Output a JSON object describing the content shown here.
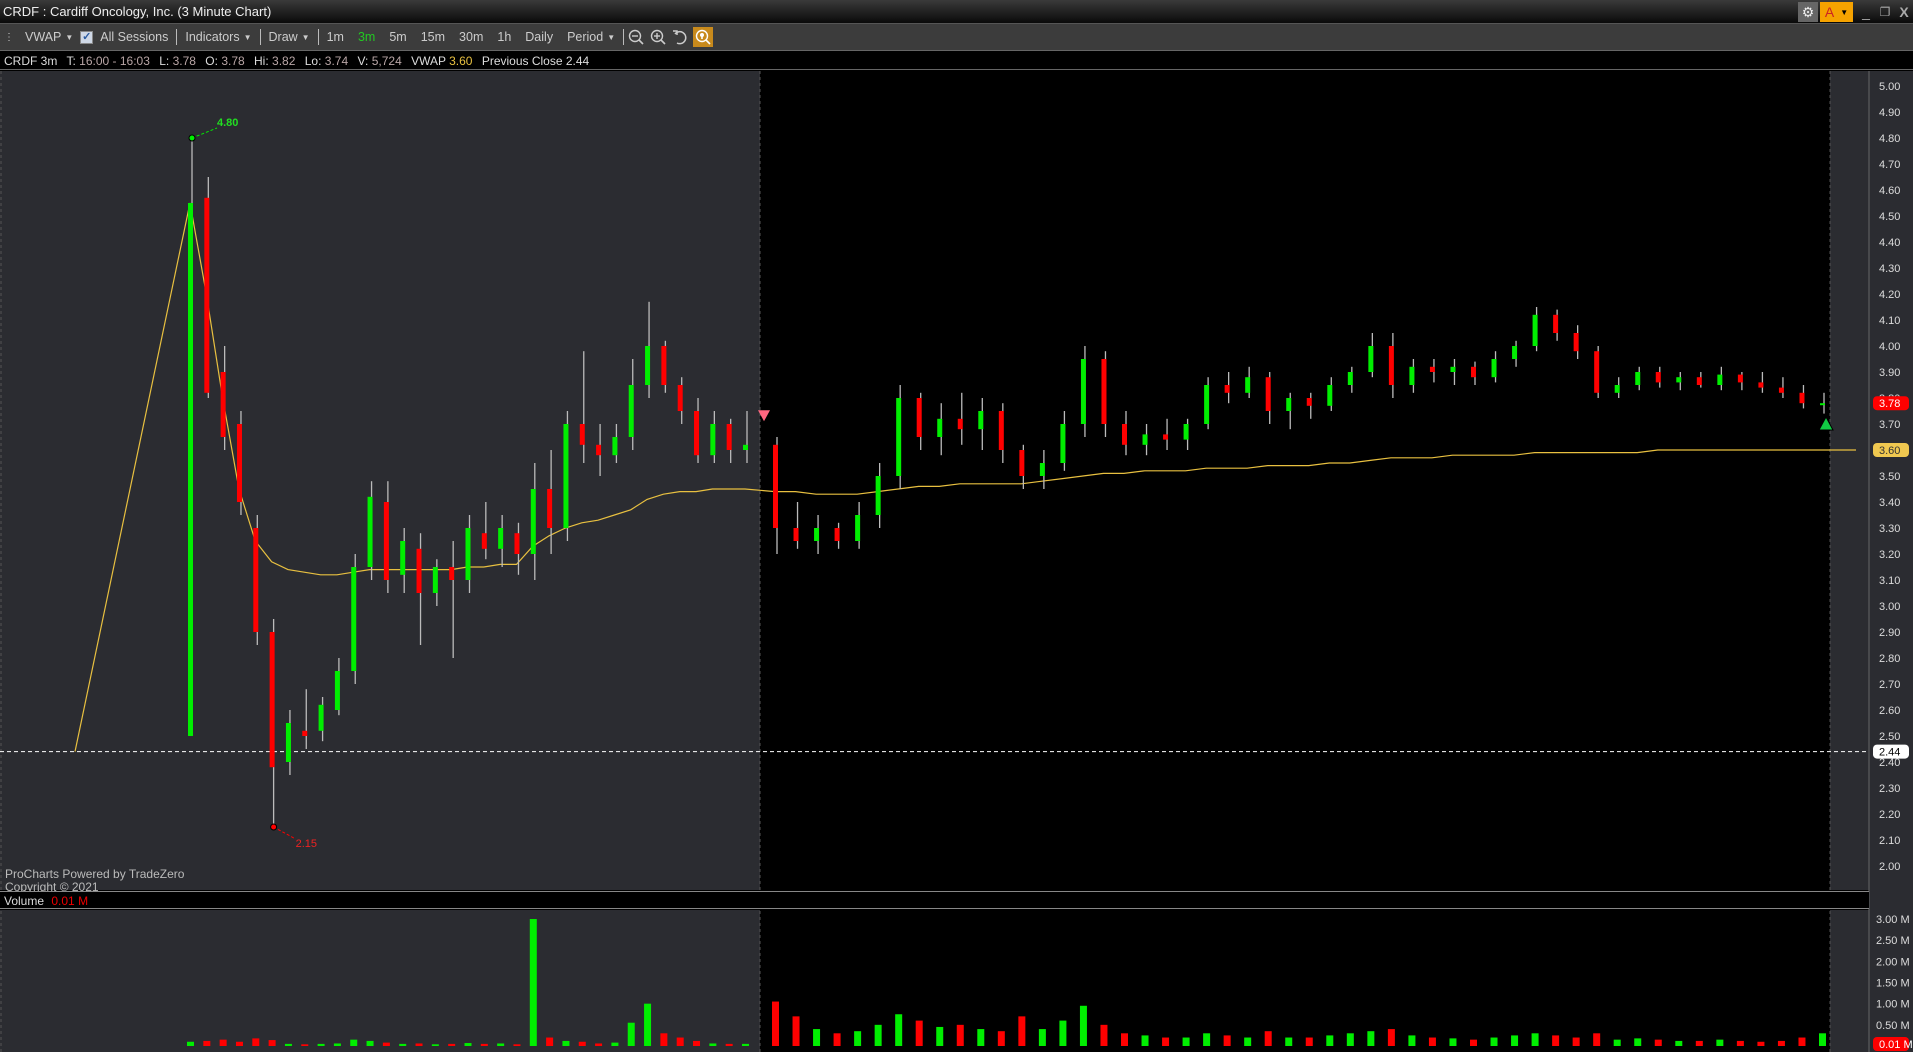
{
  "window": {
    "title": "CRDF : Cardiff Oncology, Inc. (3 Minute Chart)",
    "settings_icon": "gear-icon",
    "theme_button": "A",
    "minimize": "_",
    "restore": "❐",
    "close": "X"
  },
  "toolbar": {
    "vwap": "VWAP",
    "all_sessions": "All Sessions",
    "all_sessions_checked": true,
    "indicators": "Indicators",
    "draw": "Draw",
    "periods": [
      "1m",
      "3m",
      "5m",
      "15m",
      "30m",
      "1h",
      "Daily"
    ],
    "active_period": "3m",
    "period": "Period",
    "active_color": "#22c822"
  },
  "info": {
    "symbol": "CRDF 3m",
    "t_label": "T:",
    "t_value": "16:00 - 16:03",
    "l_label": "L:",
    "l_value": "3.78",
    "o_label": "O:",
    "o_value": "3.78",
    "hi_label": "Hi:",
    "hi_value": "3.82",
    "lo_label": "Lo:",
    "lo_value": "3.74",
    "v_label": "V:",
    "v_value": "5,724",
    "vwap_label": "VWAP",
    "vwap_value": "3.60",
    "prev_label": "Previous Close",
    "prev_value": "2.44"
  },
  "footer": {
    "line1": "ProCharts Powered by TradeZero",
    "line2": "Copyright © 2021"
  },
  "volume": {
    "label": "Volume",
    "value": "0.01 M"
  },
  "colors": {
    "up": "#00ee00",
    "down": "#ff0000",
    "vwap": "#e8c040",
    "premarket_bg": "#2b2c31",
    "regular_bg": "#000000"
  },
  "chart_data": {
    "type": "candlestick",
    "title": "CRDF : Cardiff Oncology, Inc. (3 Minute Chart)",
    "y_ticks": [
      "5.00",
      "4.90",
      "4.80",
      "4.70",
      "4.60",
      "4.50",
      "4.40",
      "4.30",
      "4.20",
      "4.10",
      "4.00",
      "3.90",
      "3.80",
      "3.70",
      "3.60",
      "3.50",
      "3.40",
      "3.30",
      "3.20",
      "3.10",
      "3.00",
      "2.90",
      "2.80",
      "2.70",
      "2.60",
      "2.50",
      "2.40",
      "2.30",
      "2.20",
      "2.10",
      "2.00"
    ],
    "ylim": [
      2.0,
      5.0
    ],
    "vol_ticks": [
      "3.00 M",
      "2.50 M",
      "2.00 M",
      "1.50 M",
      "1.00 M",
      "0.50 M"
    ],
    "vol_ylim": [
      0,
      3.0
    ],
    "last_price": "3.78",
    "vwap_last": "3.60",
    "prev_close": 2.44,
    "prev_close_label": "2.44",
    "vol_last": "0.01 M",
    "high_marker": {
      "index": 0,
      "value": 4.8,
      "label": "4.80"
    },
    "low_marker": {
      "index": 5,
      "value": 2.15,
      "label": "2.15"
    },
    "premarket_count": 35,
    "vwap_start": 2.44,
    "candles_ohlcv": [
      [
        2.5,
        4.8,
        2.5,
        4.55,
        0.1
      ],
      [
        4.57,
        4.65,
        3.8,
        3.82,
        0.12
      ],
      [
        3.9,
        4.0,
        3.6,
        3.65,
        0.15
      ],
      [
        3.7,
        3.75,
        3.35,
        3.4,
        0.1
      ],
      [
        3.3,
        3.35,
        2.85,
        2.9,
        0.18
      ],
      [
        2.9,
        2.95,
        2.15,
        2.38,
        0.14
      ],
      [
        2.4,
        2.6,
        2.35,
        2.55,
        0.05
      ],
      [
        2.52,
        2.68,
        2.45,
        2.5,
        0.04
      ],
      [
        2.52,
        2.65,
        2.48,
        2.62,
        0.05
      ],
      [
        2.6,
        2.8,
        2.58,
        2.75,
        0.06
      ],
      [
        2.75,
        3.2,
        2.7,
        3.15,
        0.15
      ],
      [
        3.15,
        3.48,
        3.1,
        3.42,
        0.12
      ],
      [
        3.4,
        3.48,
        3.05,
        3.1,
        0.08
      ],
      [
        3.12,
        3.3,
        3.05,
        3.25,
        0.05
      ],
      [
        3.22,
        3.28,
        2.85,
        3.05,
        0.06
      ],
      [
        3.05,
        3.18,
        3.0,
        3.15,
        0.04
      ],
      [
        3.15,
        3.25,
        2.8,
        3.1,
        0.05
      ],
      [
        3.1,
        3.35,
        3.05,
        3.3,
        0.07
      ],
      [
        3.28,
        3.4,
        3.18,
        3.22,
        0.05
      ],
      [
        3.22,
        3.35,
        3.15,
        3.3,
        0.06
      ],
      [
        3.28,
        3.32,
        3.12,
        3.2,
        0.04
      ],
      [
        3.2,
        3.55,
        3.1,
        3.45,
        3.0
      ],
      [
        3.45,
        3.6,
        3.2,
        3.3,
        0.2
      ],
      [
        3.3,
        3.75,
        3.25,
        3.7,
        0.12
      ],
      [
        3.7,
        3.98,
        3.55,
        3.62,
        0.1
      ],
      [
        3.62,
        3.7,
        3.5,
        3.58,
        0.06
      ],
      [
        3.58,
        3.7,
        3.55,
        3.65,
        0.08
      ],
      [
        3.65,
        3.95,
        3.6,
        3.85,
        0.55
      ],
      [
        3.85,
        4.17,
        3.8,
        4.0,
        1.0
      ],
      [
        4.0,
        4.02,
        3.82,
        3.85,
        0.3
      ],
      [
        3.85,
        3.88,
        3.7,
        3.75,
        0.2
      ],
      [
        3.75,
        3.8,
        3.55,
        3.58,
        0.12
      ],
      [
        3.58,
        3.75,
        3.55,
        3.7,
        0.06
      ],
      [
        3.7,
        3.72,
        3.55,
        3.6,
        0.05
      ],
      [
        3.6,
        3.75,
        3.55,
        3.62,
        0.05
      ],
      [
        3.62,
        3.65,
        3.2,
        3.3,
        1.05
      ],
      [
        3.3,
        3.4,
        3.22,
        3.25,
        0.7
      ],
      [
        3.25,
        3.35,
        3.2,
        3.3,
        0.4
      ],
      [
        3.3,
        3.32,
        3.22,
        3.25,
        0.3
      ],
      [
        3.25,
        3.4,
        3.22,
        3.35,
        0.35
      ],
      [
        3.35,
        3.55,
        3.3,
        3.5,
        0.5
      ],
      [
        3.5,
        3.85,
        3.45,
        3.8,
        0.75
      ],
      [
        3.8,
        3.82,
        3.6,
        3.65,
        0.6
      ],
      [
        3.65,
        3.78,
        3.58,
        3.72,
        0.45
      ],
      [
        3.72,
        3.82,
        3.62,
        3.68,
        0.5
      ],
      [
        3.68,
        3.8,
        3.6,
        3.75,
        0.4
      ],
      [
        3.75,
        3.78,
        3.55,
        3.6,
        0.35
      ],
      [
        3.6,
        3.62,
        3.45,
        3.5,
        0.7
      ],
      [
        3.5,
        3.6,
        3.45,
        3.55,
        0.4
      ],
      [
        3.55,
        3.75,
        3.52,
        3.7,
        0.6
      ],
      [
        3.7,
        4.0,
        3.65,
        3.95,
        0.95
      ],
      [
        3.95,
        3.98,
        3.65,
        3.7,
        0.5
      ],
      [
        3.7,
        3.75,
        3.58,
        3.62,
        0.3
      ],
      [
        3.62,
        3.7,
        3.58,
        3.66,
        0.25
      ],
      [
        3.66,
        3.72,
        3.6,
        3.64,
        0.2
      ],
      [
        3.64,
        3.72,
        3.6,
        3.7,
        0.2
      ],
      [
        3.7,
        3.88,
        3.68,
        3.85,
        0.3
      ],
      [
        3.85,
        3.9,
        3.78,
        3.82,
        0.25
      ],
      [
        3.82,
        3.92,
        3.8,
        3.88,
        0.2
      ],
      [
        3.88,
        3.9,
        3.7,
        3.75,
        0.35
      ],
      [
        3.75,
        3.82,
        3.68,
        3.8,
        0.2
      ],
      [
        3.8,
        3.82,
        3.72,
        3.77,
        0.2
      ],
      [
        3.77,
        3.88,
        3.75,
        3.85,
        0.25
      ],
      [
        3.85,
        3.92,
        3.82,
        3.9,
        0.3
      ],
      [
        3.9,
        4.05,
        3.88,
        4.0,
        0.35
      ],
      [
        4.0,
        4.05,
        3.8,
        3.85,
        0.4
      ],
      [
        3.85,
        3.95,
        3.82,
        3.92,
        0.25
      ],
      [
        3.92,
        3.95,
        3.86,
        3.9,
        0.2
      ],
      [
        3.9,
        3.95,
        3.85,
        3.92,
        0.18
      ],
      [
        3.92,
        3.94,
        3.85,
        3.88,
        0.15
      ],
      [
        3.88,
        3.98,
        3.86,
        3.95,
        0.2
      ],
      [
        3.95,
        4.02,
        3.92,
        4.0,
        0.25
      ],
      [
        4.0,
        4.15,
        3.98,
        4.12,
        0.3
      ],
      [
        4.12,
        4.14,
        4.02,
        4.05,
        0.25
      ],
      [
        4.05,
        4.08,
        3.95,
        3.98,
        0.2
      ],
      [
        3.98,
        4.0,
        3.8,
        3.82,
        0.3
      ],
      [
        3.82,
        3.88,
        3.8,
        3.85,
        0.15
      ],
      [
        3.85,
        3.92,
        3.83,
        3.9,
        0.18
      ],
      [
        3.9,
        3.92,
        3.84,
        3.86,
        0.15
      ],
      [
        3.86,
        3.9,
        3.83,
        3.88,
        0.12
      ],
      [
        3.88,
        3.9,
        3.84,
        3.85,
        0.12
      ],
      [
        3.85,
        3.92,
        3.83,
        3.89,
        0.15
      ],
      [
        3.89,
        3.9,
        3.83,
        3.86,
        0.12
      ],
      [
        3.86,
        3.9,
        3.82,
        3.84,
        0.1
      ],
      [
        3.84,
        3.88,
        3.8,
        3.82,
        0.12
      ],
      [
        3.82,
        3.85,
        3.76,
        3.78,
        0.2
      ],
      [
        3.78,
        3.82,
        3.74,
        3.78,
        0.3
      ]
    ],
    "vwap": [
      4.55,
      4.2,
      3.8,
      3.45,
      3.25,
      3.17,
      3.14,
      3.13,
      3.12,
      3.12,
      3.13,
      3.14,
      3.14,
      3.14,
      3.14,
      3.14,
      3.14,
      3.15,
      3.15,
      3.16,
      3.16,
      3.23,
      3.27,
      3.3,
      3.32,
      3.33,
      3.35,
      3.37,
      3.41,
      3.43,
      3.44,
      3.44,
      3.45,
      3.45,
      3.45,
      3.44,
      3.44,
      3.43,
      3.43,
      3.43,
      3.44,
      3.45,
      3.46,
      3.46,
      3.47,
      3.47,
      3.47,
      3.47,
      3.48,
      3.49,
      3.5,
      3.51,
      3.51,
      3.52,
      3.52,
      3.52,
      3.53,
      3.53,
      3.53,
      3.54,
      3.54,
      3.54,
      3.55,
      3.55,
      3.56,
      3.57,
      3.57,
      3.57,
      3.58,
      3.58,
      3.58,
      3.58,
      3.59,
      3.59,
      3.59,
      3.59,
      3.59,
      3.59,
      3.6,
      3.6,
      3.6,
      3.6,
      3.6,
      3.6,
      3.6,
      3.6,
      3.6
    ]
  }
}
